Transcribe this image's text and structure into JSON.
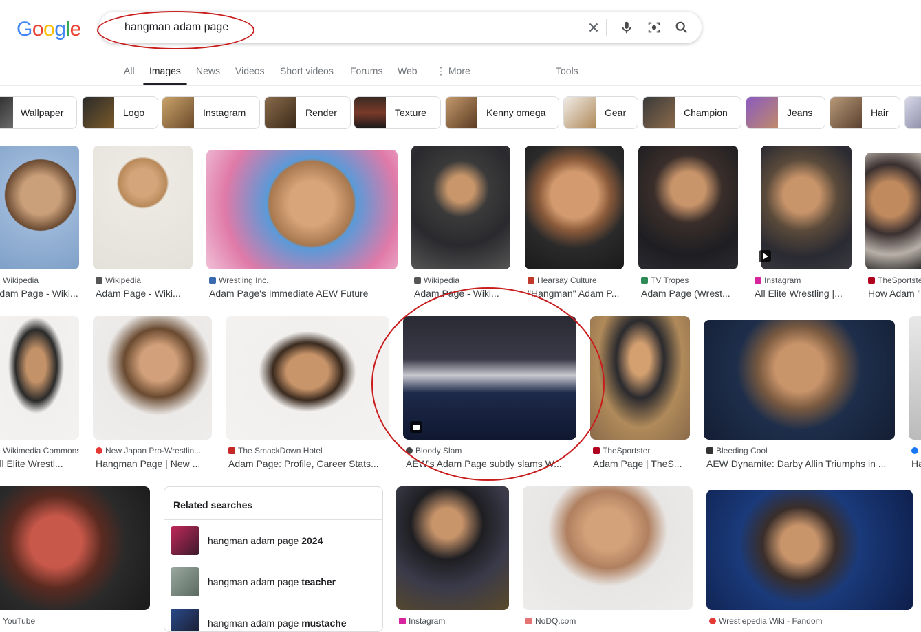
{
  "logo": {
    "letters": [
      "G",
      "o",
      "o",
      "g",
      "l",
      "e"
    ],
    "colors": [
      "#4285F4",
      "#EA4335",
      "#FBBC05",
      "#4285F4",
      "#34A853",
      "#EA4335"
    ]
  },
  "search": {
    "query": "hangman adam page",
    "icons": [
      "close-icon",
      "mic-icon",
      "camera-lens-icon",
      "search-icon"
    ]
  },
  "tabs": [
    {
      "label": "All"
    },
    {
      "label": "Images",
      "active": true
    },
    {
      "label": "News"
    },
    {
      "label": "Videos"
    },
    {
      "label": "Short videos"
    },
    {
      "label": "Forums"
    },
    {
      "label": "Web"
    },
    {
      "label": "⋮  More"
    },
    {
      "label": "Tools"
    }
  ],
  "chips": [
    "Wallpaper",
    "Logo",
    "Instagram",
    "Render",
    "Texture",
    "Kenny omega",
    "Gear",
    "Champion",
    "Jeans",
    "Hair"
  ],
  "row1": [
    {
      "source": "Wikipedia",
      "title": "Adam Page - Wiki..."
    },
    {
      "source": "Wikipedia",
      "title": "Adam Page - Wiki..."
    },
    {
      "source": "Wrestling Inc.",
      "title": "Adam Page's Immediate AEW Future"
    },
    {
      "source": "Wikipedia",
      "title": "Adam Page - Wiki..."
    },
    {
      "source": "Hearsay Culture",
      "title": "\"Hangman\" Adam P..."
    },
    {
      "source": "TV Tropes",
      "title": "Adam Page (Wrest..."
    },
    {
      "source": "Instagram",
      "title": "All Elite Wrestling |..."
    },
    {
      "source": "TheSportster",
      "title": "How Adam \""
    }
  ],
  "row2": [
    {
      "source": "Wikimedia Commons",
      "title": "All Elite Wrestl..."
    },
    {
      "source": "New Japan Pro-Wrestlin...",
      "title": "Hangman Page | New ..."
    },
    {
      "source": "The SmackDown Hotel",
      "title": "Adam Page: Profile, Career Stats..."
    },
    {
      "source": "Bloody Slam",
      "title": "AEW's Adam Page subtly slams W..."
    },
    {
      "source": "TheSportster",
      "title": "Adam Page | TheS..."
    },
    {
      "source": "Bleeding Cool",
      "title": "AEW Dynamite: Darby Allin Triumphs in ..."
    },
    {
      "source": "",
      "title": "Ha"
    }
  ],
  "row3": [
    {
      "source": "YouTube"
    },
    {
      "source": "Instagram"
    },
    {
      "source": "NoDQ.com"
    },
    {
      "source": "Wrestlepedia Wiki - Fandom"
    }
  ],
  "related": {
    "heading": "Related searches",
    "items": [
      {
        "prefix": "hangman adam page ",
        "bold": "2024"
      },
      {
        "prefix": "hangman adam page ",
        "bold": "teacher"
      },
      {
        "prefix": "hangman adam page ",
        "bold": "mustache"
      }
    ]
  },
  "colors": {
    "annotation": "#c91d1d",
    "text": "#202124",
    "muted": "#70757a"
  }
}
